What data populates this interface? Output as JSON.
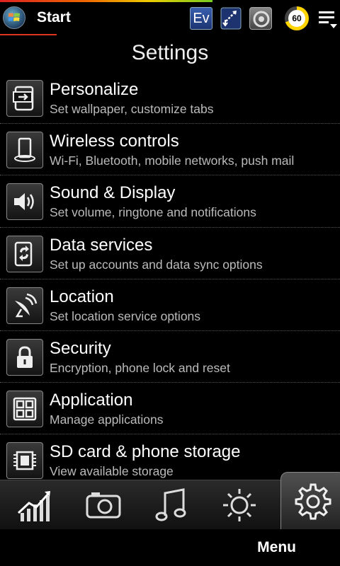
{
  "statusbar": {
    "start_label": "Start",
    "ev_label": "Ev",
    "battery_level": "60"
  },
  "page": {
    "title": "Settings"
  },
  "settings": [
    {
      "title": "Personalize",
      "subtitle": "Set wallpaper, customize tabs",
      "icon": "personalize-icon"
    },
    {
      "title": "Wireless controls",
      "subtitle": "Wi-Fi, Bluetooth, mobile networks, push mail",
      "icon": "wireless-icon"
    },
    {
      "title": "Sound & Display",
      "subtitle": "Set volume, ringtone and notifications",
      "icon": "speaker-icon"
    },
    {
      "title": "Data services",
      "subtitle": "Set up accounts and data sync options",
      "icon": "sync-icon"
    },
    {
      "title": "Location",
      "subtitle": "Set location service options",
      "icon": "satellite-dish-icon"
    },
    {
      "title": "Security",
      "subtitle": "Encryption, phone lock and reset",
      "icon": "lock-icon"
    },
    {
      "title": "Application",
      "subtitle": "Manage applications",
      "icon": "app-grid-icon"
    },
    {
      "title": "SD card & phone storage",
      "subtitle": "View available storage",
      "icon": "chip-icon"
    }
  ],
  "tabs": [
    {
      "icon": "stocks-chart-icon",
      "active": false
    },
    {
      "icon": "camera-icon",
      "active": false
    },
    {
      "icon": "music-note-icon",
      "active": false
    },
    {
      "icon": "weather-sun-icon",
      "active": false
    },
    {
      "icon": "settings-gear-icon",
      "active": true
    }
  ],
  "softkeys": {
    "right": "Menu"
  }
}
